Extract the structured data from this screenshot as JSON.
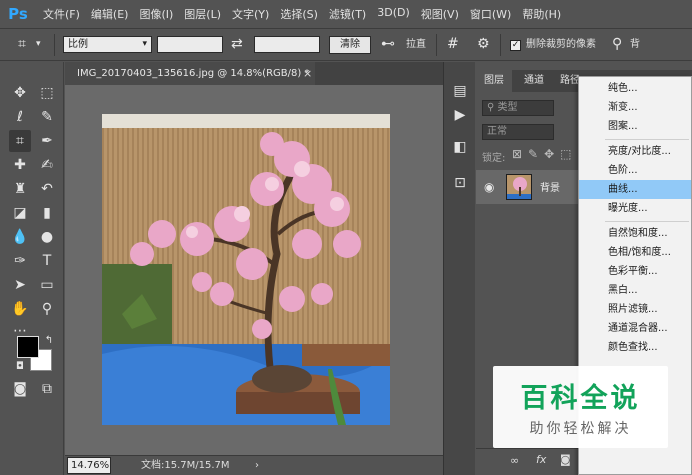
{
  "app": {
    "logo": "Ps"
  },
  "menubar": {
    "items": [
      "文件(F)",
      "编辑(E)",
      "图像(I)",
      "图层(L)",
      "文字(Y)",
      "选择(S)",
      "滤镜(T)",
      "3D(D)",
      "视图(V)",
      "窗口(W)",
      "帮助(H)"
    ]
  },
  "options": {
    "ratio": "比例",
    "clear": "清除",
    "straighten": "拉直",
    "delete_cropped": "删除裁剪的像素",
    "delete_cropped_checked": true,
    "partial": "背"
  },
  "document": {
    "tab_title": "IMG_20170403_135616.jpg @ 14.8%(RGB/8) *",
    "close_glyph": "×"
  },
  "status": {
    "zoom": "14.76%",
    "doc_info": "文档:15.7M/15.7M",
    "arrow": "›"
  },
  "layers_panel": {
    "tabs": [
      "图层",
      "通道",
      "路径"
    ],
    "kind_label": "类型",
    "blend_mode": "正常",
    "lock_label": "锁定:",
    "layer_name": "背景",
    "footer_fx": "fx"
  },
  "context_menu": {
    "items": [
      "纯色...",
      "渐变...",
      "图案...",
      "亮度/对比度...",
      "色阶...",
      "曲线...",
      "曝光度...",
      "自然饱和度...",
      "色相/饱和度...",
      "色彩平衡...",
      "黑白...",
      "照片滤镜...",
      "通道混合器...",
      "颜色查找..."
    ],
    "highlighted": "曲线..."
  },
  "watermark": {
    "title": "百科全说",
    "subtitle": "助你轻松解决"
  },
  "icons": {
    "move": "move-icon",
    "marquee": "rect-marquee-icon",
    "lasso": "lasso-icon",
    "quick_select": "quick-select-icon",
    "crop": "crop-icon",
    "eyedropper": "eyedropper-icon",
    "healing": "healing-brush-icon",
    "brush": "brush-icon",
    "stamp": "clone-stamp-icon",
    "history_brush": "history-brush-icon",
    "eraser": "eraser-icon",
    "gradient": "gradient-icon",
    "blur": "blur-icon",
    "dodge": "dodge-icon",
    "pen": "pen-icon",
    "type": "type-icon",
    "path_select": "path-select-icon",
    "shape": "rectangle-shape-icon",
    "hand": "hand-icon",
    "zoom": "zoom-icon"
  },
  "colors": {
    "accent": "#31a8ff",
    "menu_highlight": "#91c9f7",
    "watermark_green": "#12a35a"
  }
}
